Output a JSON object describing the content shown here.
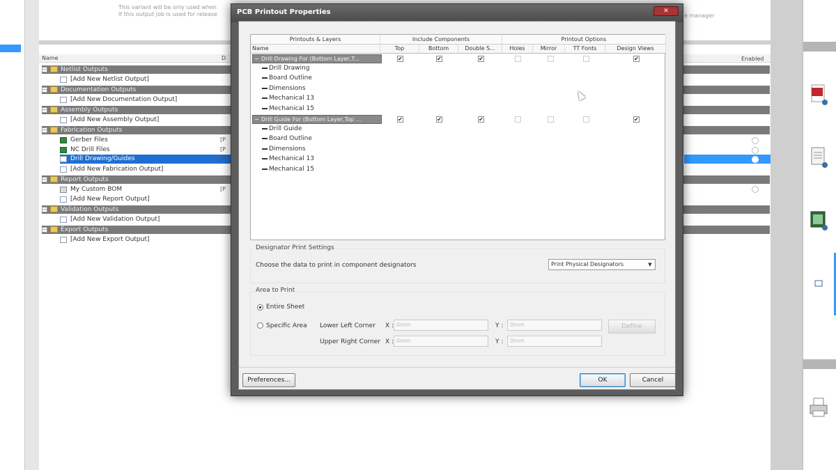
{
  "background": {
    "top_msg_line1": "This variant will be only used when",
    "top_msg_line2": "If this output job is used for release",
    "top_msg_right": "e manager",
    "grid_header": {
      "name": "Name",
      "data": "D",
      "enabled": "Enabled"
    },
    "groups": [
      {
        "label": "Netlist Outputs",
        "items": [
          {
            "label": "[Add New Netlist Output]",
            "code": ""
          }
        ]
      },
      {
        "label": "Documentation Outputs",
        "items": [
          {
            "label": "[Add New Documentation Output]",
            "code": ""
          }
        ]
      },
      {
        "label": "Assembly Outputs",
        "items": [
          {
            "label": "[Add New Assembly Output]",
            "code": ""
          }
        ]
      },
      {
        "label": "Fabrication Outputs",
        "items": [
          {
            "label": "Gerber Files",
            "code": "[P"
          },
          {
            "label": "NC Drill Files",
            "code": "[P"
          },
          {
            "label": "Drill Drawing/Guides",
            "code": "[P"
          },
          {
            "label": "[Add New Fabrication Output]",
            "code": ""
          }
        ]
      },
      {
        "label": "Report Outputs",
        "items": [
          {
            "label": "My Custom BOM",
            "code": "[P"
          },
          {
            "label": "[Add New Report Output]",
            "code": ""
          }
        ]
      },
      {
        "label": "Validation Outputs",
        "items": [
          {
            "label": "[Add New Validation Output]",
            "code": ""
          }
        ]
      },
      {
        "label": "Export Outputs",
        "items": [
          {
            "label": "[Add New Export Output]",
            "code": ""
          }
        ]
      }
    ]
  },
  "dialog": {
    "title": "PCB Printout Properties",
    "close_icon": "close-icon",
    "grid": {
      "group_headers": [
        "Printouts & Layers",
        "Include Components",
        "Printout Options"
      ],
      "columns": [
        "Name",
        "Top",
        "Bottom",
        "Double S...",
        "Holes",
        "Mirror",
        "TT Fonts",
        "Design Views"
      ],
      "printouts": [
        {
          "name": "Drill Drawing For (Bottom Layer,T...",
          "checks": [
            true,
            true,
            true,
            false,
            false,
            false,
            true
          ],
          "layers": [
            "Drill Drawing",
            "Board Outline",
            "Dimensions",
            "Mechanical 13",
            "Mechanical 15"
          ]
        },
        {
          "name": "Drill Guide For (Bottom Layer,Top ...",
          "checks": [
            true,
            true,
            true,
            false,
            false,
            false,
            true
          ],
          "layers": [
            "Drill Guide",
            "Board Outline",
            "Dimensions",
            "Mechanical 13",
            "Mechanical 15"
          ]
        }
      ]
    },
    "designator": {
      "section_label": "Designator Print Settings",
      "prompt": "Choose the data to print in component designators",
      "selected": "Print Physical Designators"
    },
    "area": {
      "section_label": "Area to Print",
      "entire_sheet": "Entire Sheet",
      "specific_area": "Specific Area",
      "lower_left": "Lower Left Corner",
      "upper_right": "Upper Right Corner",
      "x_label": "X :",
      "y_label": "Y :",
      "ll_x": "0mm",
      "ll_y": "0mm",
      "ur_x": "0mm",
      "ur_y": "0mm",
      "define_btn": "Define"
    },
    "buttons": {
      "preferences": "Preferences...",
      "ok": "OK",
      "cancel": "Cancel"
    }
  }
}
